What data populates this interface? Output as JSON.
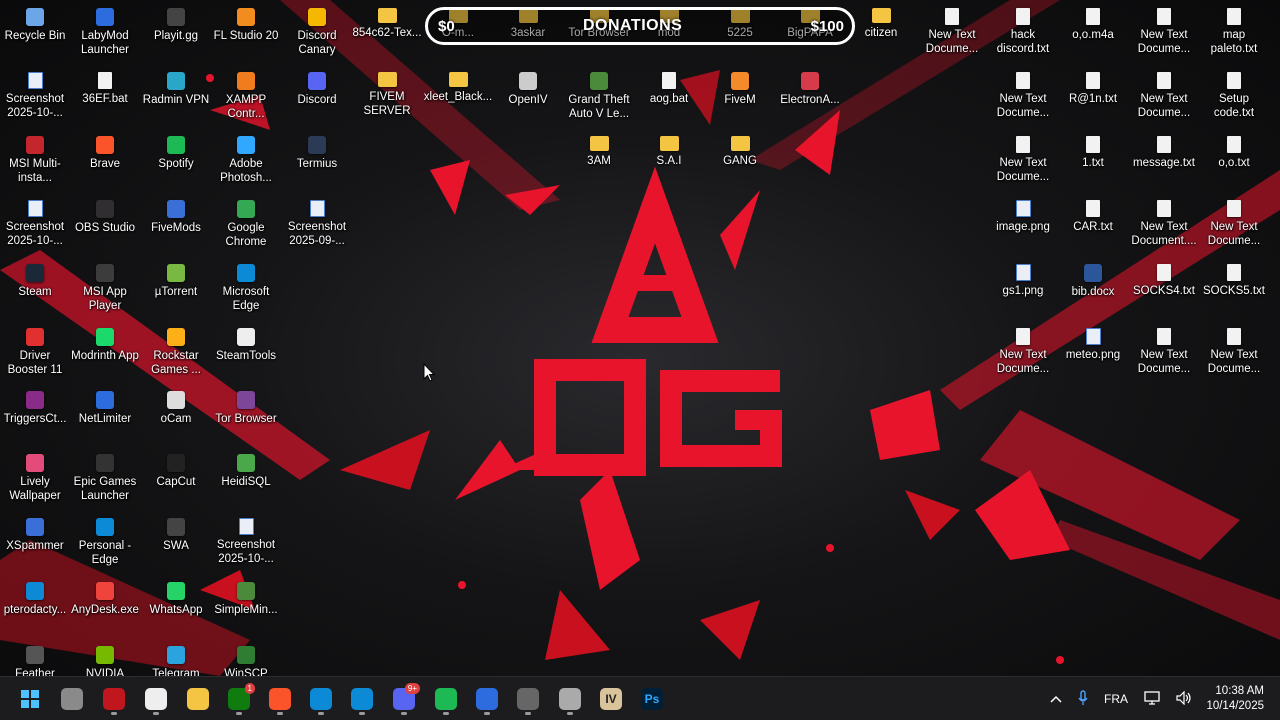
{
  "desktop": {
    "icons": [
      {
        "label": "Recycle Bin",
        "icon": "recycle-bin-icon",
        "kind": "app",
        "color": "#6aa6e8"
      },
      {
        "label": "LabyMod Launcher",
        "icon": "labymod-icon",
        "kind": "app",
        "color": "#2d6cdf"
      },
      {
        "label": "Playit.gg",
        "icon": "playit-icon",
        "kind": "app",
        "color": "#444444"
      },
      {
        "label": "FL Studio 20",
        "icon": "flstudio-icon",
        "kind": "app",
        "color": "#f28c1e"
      },
      {
        "label": "Discord Canary",
        "icon": "discord-canary-icon",
        "kind": "app",
        "color": "#f5b700"
      },
      {
        "label": "854c62-Tex...",
        "icon": "folder-icon",
        "kind": "folder"
      },
      {
        "label": "O-m...",
        "icon": "folder-icon",
        "kind": "folder"
      },
      {
        "label": "3askar",
        "icon": "folder-icon",
        "kind": "folder"
      },
      {
        "label": "Tor Browser",
        "icon": "folder-icon",
        "kind": "folder"
      },
      {
        "label": "mod",
        "icon": "folder-icon",
        "kind": "folder"
      },
      {
        "label": "5225",
        "icon": "folder-icon",
        "kind": "folder"
      },
      {
        "label": "BigPAPA",
        "icon": "folder-icon",
        "kind": "folder"
      },
      {
        "label": "citizen",
        "icon": "folder-icon",
        "kind": "folder"
      },
      {
        "label": "New Text Docume...",
        "icon": "text-document-icon",
        "kind": "doc"
      },
      {
        "label": "hack discord.txt",
        "icon": "text-document-icon",
        "kind": "doc"
      },
      {
        "label": "o,o.m4a",
        "icon": "audio-file-icon",
        "kind": "doc"
      },
      {
        "label": "New Text Docume...",
        "icon": "text-document-icon",
        "kind": "doc"
      },
      {
        "label": "map paleto.txt",
        "icon": "text-document-icon",
        "kind": "doc"
      },
      {
        "label": "Screenshot 2025-10-...",
        "icon": "image-file-icon",
        "kind": "img"
      },
      {
        "label": "36EF.bat",
        "icon": "batch-file-icon",
        "kind": "doc"
      },
      {
        "label": "Radmin VPN",
        "icon": "radmin-icon",
        "kind": "app",
        "color": "#2aa6c9"
      },
      {
        "label": "XAMPP Contr...",
        "icon": "xampp-icon",
        "kind": "app",
        "color": "#f17c1e"
      },
      {
        "label": "Discord",
        "icon": "discord-icon",
        "kind": "app",
        "color": "#5865f2"
      },
      {
        "label": "FIVEM SERVER",
        "icon": "folder-icon",
        "kind": "folder"
      },
      {
        "label": "xleet_Black...",
        "icon": "folder-icon",
        "kind": "folder"
      },
      {
        "label": "OpenIV",
        "icon": "openiv-icon",
        "kind": "app",
        "color": "#cccccc"
      },
      {
        "label": "Grand Theft Auto V Le...",
        "icon": "gta-icon",
        "kind": "app",
        "color": "#4a8a3a"
      },
      {
        "label": "aog.bat",
        "icon": "batch-file-icon",
        "kind": "doc"
      },
      {
        "label": "FiveM",
        "icon": "fivem-icon",
        "kind": "app",
        "color": "#f58a2a"
      },
      {
        "label": "ElectronA...",
        "icon": "electron-icon",
        "kind": "app",
        "color": "#d63b4c"
      },
      {
        "label": "New Text Docume...",
        "icon": "text-document-icon",
        "kind": "doc"
      },
      {
        "label": "R@1n.txt",
        "icon": "text-document-icon",
        "kind": "doc"
      },
      {
        "label": "New Text Docume...",
        "icon": "text-document-icon",
        "kind": "doc"
      },
      {
        "label": "Setup code.txt",
        "icon": "text-document-icon",
        "kind": "doc"
      },
      {
        "label": "MSI Multi-insta...",
        "icon": "msi-icon",
        "kind": "app",
        "color": "#c4262e"
      },
      {
        "label": "Brave",
        "icon": "brave-icon",
        "kind": "app",
        "color": "#fb542b"
      },
      {
        "label": "Spotify",
        "icon": "spotify-icon",
        "kind": "app",
        "color": "#1db954"
      },
      {
        "label": "Adobe Photosh...",
        "icon": "photoshop-icon",
        "kind": "app",
        "color": "#31a8ff"
      },
      {
        "label": "Termius",
        "icon": "termius-icon",
        "kind": "app",
        "color": "#2b3a55"
      },
      {
        "label": "3AM",
        "icon": "folder-icon",
        "kind": "folder"
      },
      {
        "label": "S.A.I",
        "icon": "folder-icon",
        "kind": "folder"
      },
      {
        "label": "GANG",
        "icon": "folder-icon",
        "kind": "folder"
      },
      {
        "label": "New Text Docume...",
        "icon": "text-document-icon",
        "kind": "doc"
      },
      {
        "label": "1.txt",
        "icon": "text-document-icon",
        "kind": "doc"
      },
      {
        "label": "message.txt",
        "icon": "text-document-icon",
        "kind": "doc"
      },
      {
        "label": "o,o.txt",
        "icon": "text-document-icon",
        "kind": "doc"
      },
      {
        "label": "Screenshot 2025-10-...",
        "icon": "image-file-icon",
        "kind": "img"
      },
      {
        "label": "OBS Studio",
        "icon": "obs-icon",
        "kind": "app",
        "color": "#302e31"
      },
      {
        "label": "FiveMods",
        "icon": "fivemods-icon",
        "kind": "app",
        "color": "#3a6fd8"
      },
      {
        "label": "Google Chrome",
        "icon": "chrome-icon",
        "kind": "app",
        "color": "#34a853"
      },
      {
        "label": "Screenshot 2025-09-...",
        "icon": "image-file-icon",
        "kind": "img"
      },
      {
        "label": "image.png",
        "icon": "image-file-icon",
        "kind": "img"
      },
      {
        "label": "CAR.txt",
        "icon": "text-document-icon",
        "kind": "doc"
      },
      {
        "label": "New Text Document....",
        "icon": "text-document-icon",
        "kind": "doc"
      },
      {
        "label": "New Text Docume...",
        "icon": "text-document-icon",
        "kind": "doc"
      },
      {
        "label": "Steam",
        "icon": "steam-icon",
        "kind": "app",
        "color": "#1b2838"
      },
      {
        "label": "MSI App Player",
        "icon": "msi-app-player-icon",
        "kind": "app",
        "color": "#3c3c3c"
      },
      {
        "label": "µTorrent",
        "icon": "utorrent-icon",
        "kind": "app",
        "color": "#78b843"
      },
      {
        "label": "Microsoft Edge",
        "icon": "edge-icon",
        "kind": "app",
        "color": "#0c8ad6"
      },
      {
        "label": "gs1.png",
        "icon": "image-file-icon",
        "kind": "img"
      },
      {
        "label": "bib.docx",
        "icon": "word-document-icon",
        "kind": "app",
        "color": "#2b579a"
      },
      {
        "label": "SOCKS4.txt",
        "icon": "text-document-icon",
        "kind": "doc"
      },
      {
        "label": "SOCKS5.txt",
        "icon": "text-document-icon",
        "kind": "doc"
      },
      {
        "label": "Driver Booster 11",
        "icon": "driver-booster-icon",
        "kind": "app",
        "color": "#e03030"
      },
      {
        "label": "Modrinth App",
        "icon": "modrinth-icon",
        "kind": "app",
        "color": "#1bd96a"
      },
      {
        "label": "Rockstar Games ...",
        "icon": "rockstar-icon",
        "kind": "app",
        "color": "#fcaf17"
      },
      {
        "label": "SteamTools",
        "icon": "steamtools-icon",
        "kind": "app",
        "color": "#eeeeee"
      },
      {
        "label": "New Text Docume...",
        "icon": "text-document-icon",
        "kind": "doc"
      },
      {
        "label": "meteo.png",
        "icon": "image-file-icon",
        "kind": "img"
      },
      {
        "label": "New Text Docume...",
        "icon": "text-document-icon",
        "kind": "doc"
      },
      {
        "label": "New Text Docume...",
        "icon": "text-document-icon",
        "kind": "doc"
      },
      {
        "label": "TriggersCt...",
        "icon": "archive-icon",
        "kind": "app",
        "color": "#8a2b8a"
      },
      {
        "label": "NetLimiter",
        "icon": "netlimiter-icon",
        "kind": "app",
        "color": "#2d6cdf"
      },
      {
        "label": "oCam",
        "icon": "ocam-icon",
        "kind": "app",
        "color": "#dddddd"
      },
      {
        "label": "Tor Browser",
        "icon": "tor-browser-icon",
        "kind": "app",
        "color": "#7d4698"
      },
      {
        "label": "Lively Wallpaper",
        "icon": "lively-icon",
        "kind": "app",
        "color": "#e34c7a"
      },
      {
        "label": "Epic Games Launcher",
        "icon": "epic-games-icon",
        "kind": "app",
        "color": "#333333"
      },
      {
        "label": "CapCut",
        "icon": "capcut-icon",
        "kind": "app",
        "color": "#222222"
      },
      {
        "label": "HeidiSQL",
        "icon": "heidisql-icon",
        "kind": "app",
        "color": "#4aa84a"
      },
      {
        "label": "XSpammer",
        "icon": "xspammer-icon",
        "kind": "app",
        "color": "#3a6fd8"
      },
      {
        "label": "Personal - Edge",
        "icon": "edge-icon",
        "kind": "app",
        "color": "#0c8ad6"
      },
      {
        "label": "SWA",
        "icon": "swa-icon",
        "kind": "app",
        "color": "#444444"
      },
      {
        "label": "Screenshot 2025-10-...",
        "icon": "image-file-icon",
        "kind": "img"
      },
      {
        "label": "pterodacty...",
        "icon": "edge-icon",
        "kind": "app",
        "color": "#0c8ad6"
      },
      {
        "label": "AnyDesk.exe",
        "icon": "anydesk-icon",
        "kind": "app",
        "color": "#ef443b"
      },
      {
        "label": "WhatsApp",
        "icon": "whatsapp-icon",
        "kind": "app",
        "color": "#25d366"
      },
      {
        "label": "SimpleMin...",
        "icon": "simplemin-icon",
        "kind": "app",
        "color": "#4a8a3a"
      },
      {
        "label": "Feather",
        "icon": "feather-icon",
        "kind": "app",
        "color": "#555555"
      },
      {
        "label": "NVIDIA",
        "icon": "nvidia-icon",
        "kind": "app",
        "color": "#76b900"
      },
      {
        "label": "Telegram",
        "icon": "telegram-icon",
        "kind": "app",
        "color": "#2aa3df"
      },
      {
        "label": "WinSCP",
        "icon": "winscp-icon",
        "kind": "app",
        "color": "#2f7d32"
      }
    ]
  },
  "donations": {
    "min": "$0",
    "title": "DONATIONS",
    "max": "$100",
    "progress": 0
  },
  "wallpaper": {
    "logo_text_top": "A",
    "logo_text_bottom": "OG",
    "accent": "#e8142c"
  },
  "taskbar": {
    "buttons": [
      {
        "name": "start-button",
        "icon": "windows-start-icon",
        "color": "#3aa0ff",
        "glyph": ""
      },
      {
        "name": "task-view-button",
        "icon": "task-view-icon",
        "color": "#8a8a8a",
        "glyph": ""
      },
      {
        "name": "taskbar-app-1",
        "icon": "red-app-icon",
        "color": "#c0171f",
        "glyph": ""
      },
      {
        "name": "taskbar-github",
        "icon": "github-icon",
        "color": "#eeeeee",
        "glyph": ""
      },
      {
        "name": "taskbar-file-explorer",
        "icon": "file-explorer-icon",
        "color": "#f4c542",
        "glyph": ""
      },
      {
        "name": "taskbar-xbox",
        "icon": "xbox-icon",
        "color": "#107c10",
        "glyph": "",
        "badge": "1"
      },
      {
        "name": "taskbar-brave",
        "icon": "brave-icon",
        "color": "#fb542b",
        "glyph": ""
      },
      {
        "name": "taskbar-edge",
        "icon": "edge-icon",
        "color": "#0c8ad6",
        "glyph": ""
      },
      {
        "name": "taskbar-edge-2",
        "icon": "edge-icon",
        "color": "#0c8ad6",
        "glyph": ""
      },
      {
        "name": "taskbar-discord",
        "icon": "discord-icon",
        "color": "#5865f2",
        "glyph": "",
        "badge": "9+"
      },
      {
        "name": "taskbar-spotify",
        "icon": "spotify-icon",
        "color": "#1db954",
        "glyph": ""
      },
      {
        "name": "taskbar-app-2",
        "icon": "remote-desktop-icon",
        "color": "#2d6cdf",
        "glyph": ""
      },
      {
        "name": "taskbar-app-3",
        "icon": "steam-icon",
        "color": "#666666",
        "glyph": ""
      },
      {
        "name": "taskbar-app-4",
        "icon": "tools-icon",
        "color": "#aaaaaa",
        "glyph": ""
      },
      {
        "name": "taskbar-openiv",
        "icon": "openiv-icon",
        "color": "#d9c39a",
        "glyph": "IV"
      },
      {
        "name": "taskbar-photoshop",
        "icon": "photoshop-icon",
        "color": "#001e36",
        "glyph": "Ps"
      }
    ],
    "tray": {
      "chevron": "chevron-up-icon",
      "mic": "microphone-icon",
      "language": "FRA",
      "network": "network-icon",
      "volume": "volume-icon"
    },
    "clock": {
      "time": "10:38 AM",
      "date": "10/14/2025"
    }
  }
}
